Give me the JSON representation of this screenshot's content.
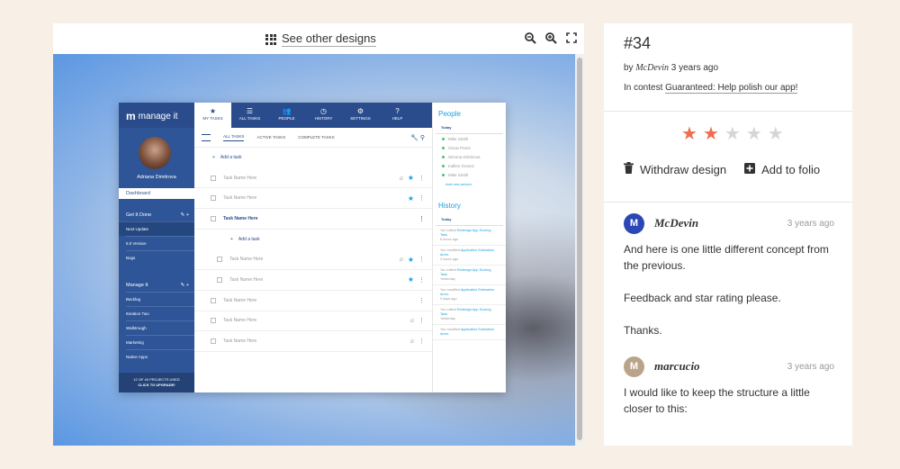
{
  "viewer": {
    "see_other_label": "See other designs",
    "icons": [
      "grid-icon",
      "zoom-out-icon",
      "zoom-in-icon",
      "fullscreen-icon"
    ]
  },
  "mockup": {
    "logo": "manage it",
    "nav": [
      {
        "icon": "★",
        "label": "MY TASKS",
        "active": true
      },
      {
        "icon": "☰",
        "label": "ALL TASKS"
      },
      {
        "icon": "👥",
        "label": "PEOPLE"
      },
      {
        "icon": "◷",
        "label": "HISTORY"
      },
      {
        "icon": "⚙",
        "label": "SETTINGS"
      },
      {
        "icon": "?",
        "label": "HELP"
      }
    ],
    "user_name": "Adriana Dimitrova",
    "dashboard": "Dashboard",
    "section1": {
      "title": "Get It Done",
      "items": [
        "Next Update",
        "5.0 Version",
        "Bugs"
      ]
    },
    "section2": {
      "title": "Manage It",
      "items": [
        "Backlog",
        "Iteration Two",
        "Walktrough",
        "Marketing",
        "Native Apps"
      ]
    },
    "footer_line1": "12 OF 40 PROJECTS USED",
    "footer_line2": "CLICK TO UPGRADE!",
    "tabs": [
      "ALL TASKS",
      "ACTIVE TASKS",
      "COMPLETE TASKS"
    ],
    "add_task": "Add a task",
    "task_name": "Task Name Here",
    "people_title": "People",
    "today": "Today",
    "people": [
      "Mike Smith",
      "Oscar Perez",
      "Simona Dimitrova",
      "Indilen Gomez",
      "Mike Smith"
    ],
    "add_person": "Add new person",
    "history_title": "History",
    "history": [
      {
        "pre": "You edited",
        "link": "Redesign App Scoring Task.",
        "time": "8 hours ago"
      },
      {
        "pre": "You modified",
        "link": "Application Estimation Amm.",
        "time": "2 hours ago"
      },
      {
        "pre": "You edited",
        "link": "Redesign App Scoring Task.",
        "time": "Yesterday"
      },
      {
        "pre": "You modified",
        "link": "Application Estimation Amm.",
        "time": "3 days ago"
      },
      {
        "pre": "You edited",
        "link": "Redesign App Scoring Task.",
        "time": "Yesterday"
      },
      {
        "pre": "You modified",
        "link": "Application Estimation Amm.",
        "time": ""
      }
    ]
  },
  "panel": {
    "number": "#34",
    "by_prefix": "by",
    "author": "McDevin",
    "time": "3 years ago",
    "contest_prefix": "In contest",
    "contest_link": "Guaranteed: Help polish our app!",
    "rating": 2,
    "rating_max": 5,
    "star_on_color": "#f26d4f",
    "withdraw_label": "Withdraw design",
    "add_folio_label": "Add to folio",
    "comments": [
      {
        "initial": "M",
        "avatar_color": "#2b47b5",
        "user": "McDevin",
        "time": "3 years ago",
        "paragraphs": [
          "And here is one little different concept from the previous.",
          "Feedback and star rating please.",
          "Thanks."
        ]
      },
      {
        "initial": "M",
        "avatar_color": "#b9a489",
        "user": "marcucio",
        "time": "3 years ago",
        "paragraphs": [
          "I would like to keep the structure a little closer to this:"
        ]
      }
    ]
  }
}
